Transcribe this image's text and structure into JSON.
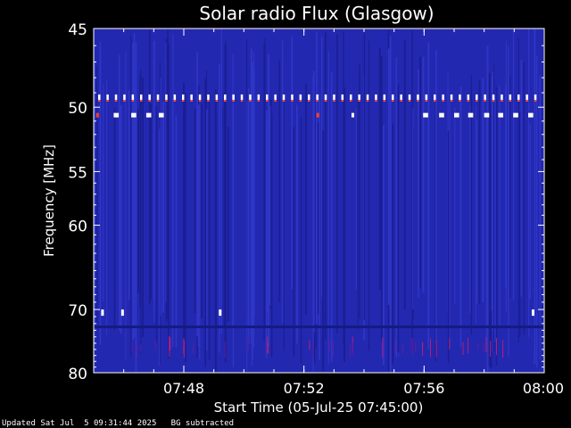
{
  "chart_data": {
    "type": "heatmap",
    "title": "Solar radio Flux (Glasgow)",
    "ylabel": "Frequency [MHz]",
    "xlabel": "Start Time (05-Jul-25 07:45:00)",
    "ylim": [
      45,
      80
    ],
    "y_scale": "reciprocal",
    "y_ticks": [
      45,
      50,
      55,
      60,
      70,
      80
    ],
    "xlim": [
      "07:45",
      "08:00"
    ],
    "x_ticks": [
      "07:48",
      "07:52",
      "07:56",
      "08:00"
    ],
    "background_color": "#2328b0",
    "grid": false,
    "features": {
      "dotted_band_mhz": 49.3,
      "band_segments_mhz": 50.6,
      "segments": [
        {
          "start": "07:45:05",
          "end": "07:45:10",
          "color": "#ff4020"
        },
        {
          "start": "07:45:40",
          "end": "07:45:50",
          "color": "#ffffff"
        },
        {
          "start": "07:46:15",
          "end": "07:46:25",
          "color": "#ffffff"
        },
        {
          "start": "07:46:45",
          "end": "07:46:55",
          "color": "#ffffff"
        },
        {
          "start": "07:47:10",
          "end": "07:47:20",
          "color": "#ffffff"
        },
        {
          "start": "07:52:25",
          "end": "07:52:30",
          "color": "#ff4020"
        },
        {
          "start": "07:53:35",
          "end": "07:53:40",
          "color": "#ffffff"
        },
        {
          "start": "07:55:58",
          "end": "07:56:08",
          "color": "#ffffff"
        },
        {
          "start": "07:56:30",
          "end": "07:56:40",
          "color": "#ffffff"
        },
        {
          "start": "07:57:00",
          "end": "07:57:10",
          "color": "#ffffff"
        },
        {
          "start": "07:57:28",
          "end": "07:57:38",
          "color": "#ffffff"
        },
        {
          "start": "07:58:00",
          "end": "07:58:10",
          "color": "#ffffff"
        },
        {
          "start": "07:58:28",
          "end": "07:58:38",
          "color": "#ffffff"
        },
        {
          "start": "07:58:58",
          "end": "07:59:08",
          "color": "#ffffff"
        },
        {
          "start": "07:59:28",
          "end": "07:59:38",
          "color": "#ffffff"
        }
      ],
      "low_band_mhz": 70.5,
      "low_band_marks": [
        "07:45:15",
        "07:45:55",
        "07:49:10",
        "07:59:35"
      ]
    }
  },
  "footer": {
    "updated": "Updated Sat Jul  5 09:31:44 2025   BG subtracted"
  }
}
